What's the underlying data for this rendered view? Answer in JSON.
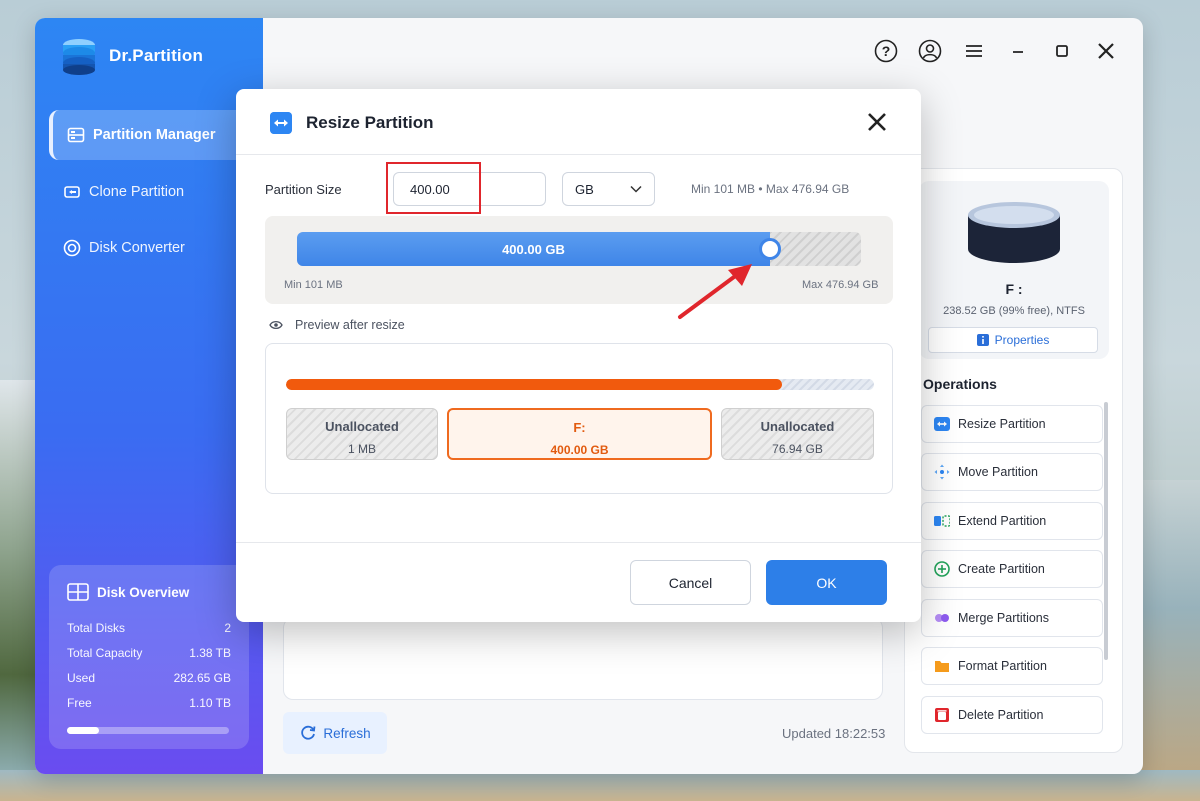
{
  "app": {
    "name": "Dr.Partition",
    "brand_color": "#2d86f3"
  },
  "sidebar": {
    "items": [
      {
        "label": "Partition Manager",
        "icon": "partition-manager-icon",
        "active": true
      },
      {
        "label": "Clone Partition",
        "icon": "clone-icon",
        "active": false
      },
      {
        "label": "Disk Converter",
        "icon": "disk-converter-icon",
        "active": false
      }
    ],
    "overview": {
      "title": "Disk Overview",
      "rows": [
        {
          "label": "Total Disks",
          "value": "2"
        },
        {
          "label": "Total Capacity",
          "value": "1.38 TB"
        },
        {
          "label": "Used",
          "value": "282.65 GB"
        },
        {
          "label": "Free",
          "value": "1.10 TB"
        }
      ],
      "usage_fraction": 0.2
    }
  },
  "topbar": {
    "icons": [
      "help-icon",
      "account-icon",
      "menu-icon",
      "minimize-icon",
      "maximize-icon",
      "close-icon"
    ]
  },
  "right_panel": {
    "disk_label": "F :",
    "disk_info": "238.52 GB (99% free), NTFS",
    "properties_label": "Properties",
    "operations_title": "Operations",
    "operations": [
      {
        "label": "Resize Partition",
        "icon": "resize-icon",
        "color": "#2d86f3"
      },
      {
        "label": "Move Partition",
        "icon": "move-icon",
        "color": "#2d86f3"
      },
      {
        "label": "Extend Partition",
        "icon": "extend-icon",
        "color": "#2d86f3"
      },
      {
        "label": "Create Partition",
        "icon": "create-icon",
        "color": "#22a35a"
      },
      {
        "label": "Merge Partitions",
        "icon": "merge-icon",
        "color": "#8e5cf0"
      },
      {
        "label": "Format Partition",
        "icon": "format-icon",
        "color": "#f59b1c"
      },
      {
        "label": "Delete Partition",
        "icon": "delete-icon",
        "color": "#e0262c"
      }
    ]
  },
  "footer": {
    "refresh_label": "Refresh",
    "updated": "Updated 18:22:53"
  },
  "dialog": {
    "title": "Resize Partition",
    "partition_size_label": "Partition Size",
    "size_value": "400.00",
    "unit": "GB",
    "range_text": "Min 101 MB • Max 476.94 GB",
    "slider": {
      "value_label": "400.00 GB",
      "fraction": 0.839,
      "min_label": "Min 101 MB",
      "max_label": "Max 476.94 GB"
    },
    "preview_label": "Preview after resize",
    "preview": {
      "bar_fraction": 0.843,
      "blocks": [
        {
          "name": "Unallocated",
          "size": "1 MB"
        },
        {
          "name": "F:",
          "size": "400.00 GB"
        },
        {
          "name": "Unallocated",
          "size": "76.94 GB"
        }
      ]
    },
    "cancel_label": "Cancel",
    "ok_label": "OK"
  }
}
